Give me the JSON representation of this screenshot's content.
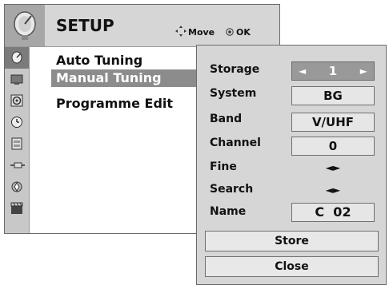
{
  "header": {
    "title": "SETUP",
    "move_label": "Move",
    "ok_label": "OK"
  },
  "icons": [
    "setup-icon",
    "picture-icon",
    "audio-icon",
    "time-icon",
    "option-icon",
    "input-icon",
    "usb-icon",
    "movie-icon"
  ],
  "menu": {
    "items": [
      {
        "label": "Auto Tuning"
      },
      {
        "label": "Manual Tuning"
      },
      {
        "label": "Programme Edit"
      }
    ]
  },
  "tuning": {
    "storage_label": "Storage",
    "storage_value": "1",
    "system_label": "System",
    "system_value": "BG",
    "band_label": "Band",
    "band_value": "V/UHF",
    "channel_label": "Channel",
    "channel_value": "0",
    "fine_label": "Fine",
    "search_label": "Search",
    "name_label": "Name",
    "name_value": "C  02",
    "store_button": "Store",
    "close_button": "Close"
  }
}
